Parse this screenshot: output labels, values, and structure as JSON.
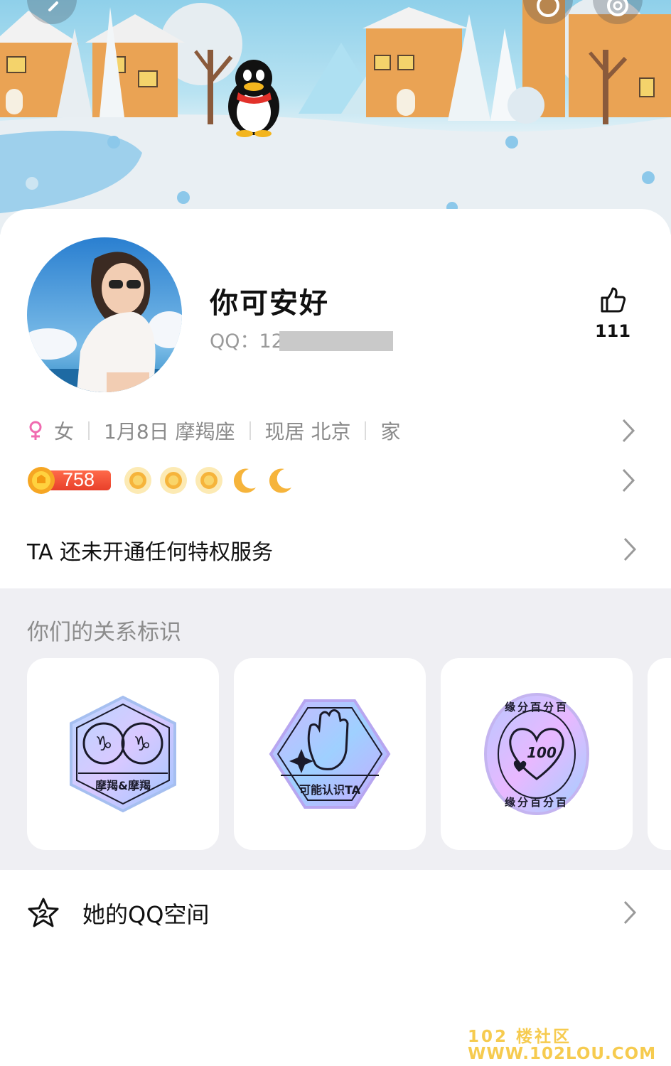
{
  "profile": {
    "nickname": "你可安好",
    "qq_label": "QQ：12",
    "likes": "111"
  },
  "info": {
    "gender": "女",
    "birthday": "1月8日 摩羯座",
    "location": "现居 北京",
    "hometown": "家"
  },
  "level": {
    "value": "758",
    "icons": [
      "sun-icon",
      "sun-icon",
      "sun-icon",
      "moon-icon",
      "moon-icon"
    ]
  },
  "privilege": {
    "text": "TA 还未开通任何特权服务"
  },
  "relations": {
    "title": "你们的关系标识",
    "badges": [
      {
        "label": "摩羯&摩羯",
        "icon": "capricorn-badge-icon"
      },
      {
        "label": "可能认识TA",
        "icon": "waving-hand-badge-icon"
      },
      {
        "label": "缘分百分百",
        "icon": "heart-100-badge-icon"
      }
    ]
  },
  "space": {
    "label": "她的QQ空间"
  },
  "watermark": {
    "line1": "102楼社区",
    "line2": "www.102LOU.COM",
    "line3": "102 楼社区",
    "line4": "WWW.102LOU.COM"
  },
  "colors": {
    "level_badge": "#e8402a",
    "female": "#f06bb0",
    "section_bg": "#efeff3"
  }
}
